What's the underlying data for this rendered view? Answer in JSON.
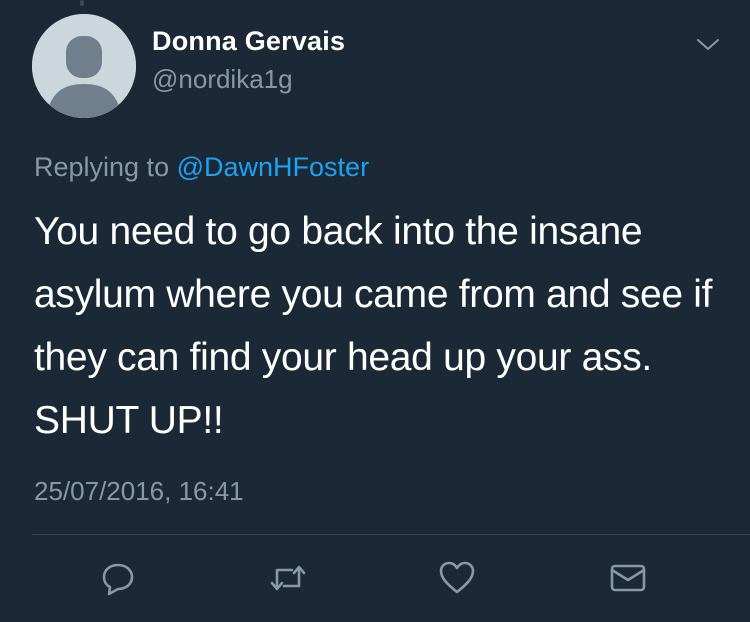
{
  "user": {
    "display_name": "Donna Gervais",
    "handle": "@nordika1g"
  },
  "reply": {
    "prefix": "Replying to",
    "mention": "@DawnHFoster"
  },
  "tweet": {
    "text": "You need to go back into the insane asylum where you came from and see if they can find your head up your ass.  SHUT UP!!",
    "timestamp": "25/07/2016, 16:41"
  },
  "icons": {
    "menu": "chevron-down-icon",
    "reply": "reply-icon",
    "retweet": "retweet-icon",
    "like": "heart-icon",
    "dm": "envelope-icon",
    "avatar": "default-avatar-icon"
  },
  "colors": {
    "background": "#1b2836",
    "text": "#ffffff",
    "secondary": "#8899a6",
    "link": "#1da1f2"
  }
}
